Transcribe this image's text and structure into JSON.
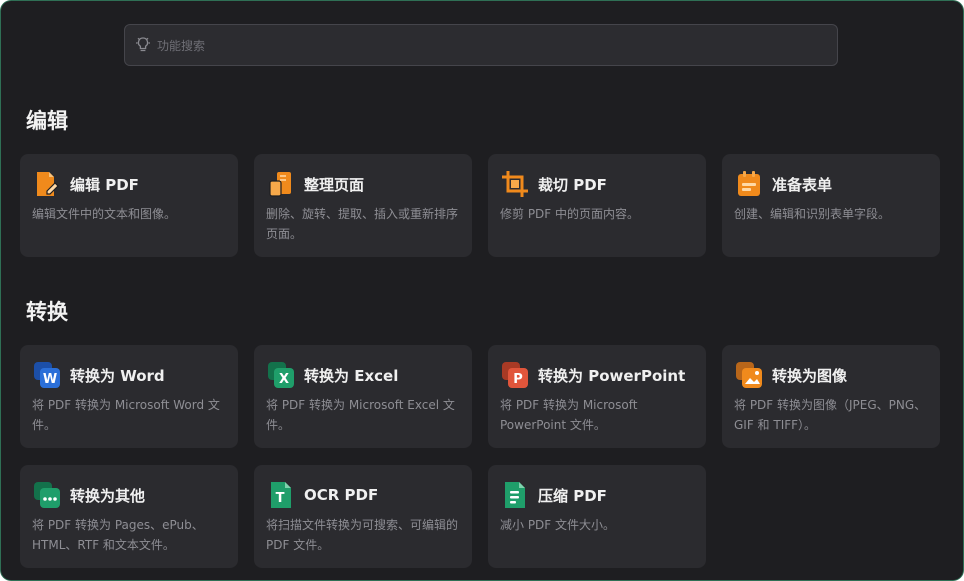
{
  "search": {
    "placeholder": "功能搜索"
  },
  "sections": [
    {
      "title": "编辑",
      "cards": [
        {
          "title": "编辑 PDF",
          "desc": "编辑文件中的文本和图像。",
          "icon": "edit-pdf-icon"
        },
        {
          "title": "整理页面",
          "desc": "删除、旋转、提取、插入或重新排序页面。",
          "icon": "organize-pages-icon"
        },
        {
          "title": "裁切 PDF",
          "desc": "修剪 PDF 中的页面内容。",
          "icon": "crop-icon"
        },
        {
          "title": "准备表单",
          "desc": "创建、编辑和识别表单字段。",
          "icon": "form-icon"
        }
      ]
    },
    {
      "title": "转换",
      "cards": [
        {
          "title": "转换为 Word",
          "desc": "将 PDF 转换为 Microsoft Word 文件。",
          "icon": "word-icon"
        },
        {
          "title": "转换为 Excel",
          "desc": "将 PDF 转换为 Microsoft Excel 文件。",
          "icon": "excel-icon"
        },
        {
          "title": "转换为 PowerPoint",
          "desc": "将 PDF 转换为 Microsoft PowerPoint 文件。",
          "icon": "powerpoint-icon"
        },
        {
          "title": "转换为图像",
          "desc": "将 PDF 转换为图像（JPEG、PNG、GIF 和 TIFF）。",
          "icon": "image-icon"
        },
        {
          "title": "转换为其他",
          "desc": "将 PDF 转换为 Pages、ePub、HTML、RTF 和文本文件。",
          "icon": "other-formats-icon"
        },
        {
          "title": "OCR PDF",
          "desc": "将扫描文件转换为可搜索、可编辑的 PDF 文件。",
          "icon": "ocr-icon"
        },
        {
          "title": "压缩 PDF",
          "desc": "减小 PDF 文件大小。",
          "icon": "compress-icon"
        }
      ]
    }
  ],
  "colors": {
    "background": "#1e1e21",
    "card": "#2b2b2f",
    "orange": "#f08a1c",
    "word_blue": "#2b6fd8",
    "excel_green": "#1f9e6a",
    "ppt_red": "#e0553b"
  }
}
